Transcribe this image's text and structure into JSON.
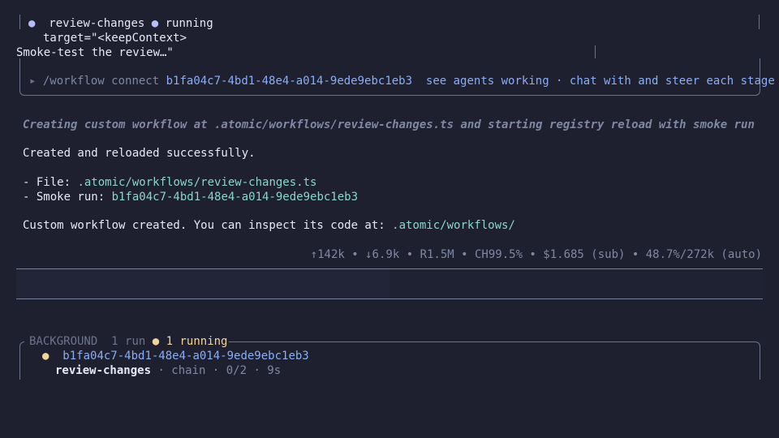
{
  "top_box": {
    "dot": "●",
    "workflow_name": "review-changes",
    "status_dot": "●",
    "status": "running",
    "target_line": "target=\"<keepContext>",
    "prompt_line": "Smoke-test the review…\""
  },
  "connect_box": {
    "arrow": "▸",
    "command": "/workflow connect",
    "run_id": "b1fa04c7-4bd1-48e4-a014-9ede9ebc1eb3",
    "hint": "see agents working · chat with and steer each stage"
  },
  "messages": {
    "status_italic": "Creating custom workflow at .atomic/workflows/review-changes.ts and starting registry reload with smoke run",
    "created": "Created and reloaded successfully.",
    "file_label": "- File: ",
    "file_path": ".atomic/workflows/review-changes.ts",
    "smoke_label": "- Smoke run: ",
    "smoke_id": "b1fa04c7-4bd1-48e4-a014-9ede9ebc1eb3",
    "final_prefix": "Custom workflow created. You can inspect its code at: ",
    "final_path": ".atomic/workflows/"
  },
  "stats_line": "↑142k • ↓6.9k • R1.5M • CH99.5% • $1.685 (sub) • 48.7%/272k (auto)",
  "background_panel": {
    "title": "BACKGROUND",
    "count": "1 run",
    "running_dot": "●",
    "running": "1 running",
    "run_dot": "●",
    "run_id": "b1fa04c7-4bd1-48e4-a014-9ede9ebc1eb3",
    "run_name": "review-changes",
    "run_meta": " · chain · 0/2 · 9s"
  },
  "colors": {
    "background": "#1e2030",
    "accent_blue": "#8aadf4",
    "path_teal": "#8bd5ca",
    "running_yellow": "#eed49f",
    "border": "#6e738d"
  }
}
